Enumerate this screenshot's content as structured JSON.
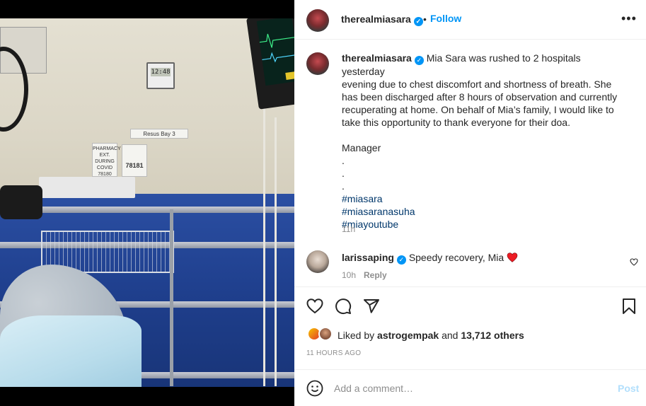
{
  "post_header": {
    "username": "therealmiasara",
    "separator": "•",
    "follow_label": "Follow",
    "more_icon": "more-horizontal-icon"
  },
  "photo": {
    "clock_text": "12:48",
    "sign_bay": "Resus Bay 3",
    "sign_pharmacy": "PHARMACY EXT. DURING COVID 78180",
    "sign_ext": "78181"
  },
  "caption": {
    "username": "therealmiasara",
    "lines": [
      "Mia Sara was rushed to 2 hospitals yesterday",
      "evening due to chest discomfort and shortness of breath. She",
      "has been discharged after 8 hours of observation and currently",
      "recuperating at home. On behalf of Mia’s family, I would like to",
      "take this opportunity to thank everyone for their doa."
    ],
    "signoff": "Manager",
    "dots": [
      ".",
      ".",
      "."
    ],
    "hashtags": [
      "#miasara",
      "#miasaranasuha",
      "#miayoutube"
    ],
    "time": "11h"
  },
  "comment": {
    "username": "larissaping",
    "text": "Speedy recovery, Mia",
    "emoji": "❤️",
    "time": "10h",
    "reply_label": "Reply"
  },
  "actions": {
    "like_icon": "heart-icon",
    "comment_icon": "comment-icon",
    "share_icon": "send-icon",
    "save_icon": "bookmark-icon",
    "liked_by_prefix": "Liked by",
    "liked_by_user": "astrogempak",
    "liked_by_and": "and",
    "likes_others": "13,712 others",
    "posted_ago": "11 HOURS AGO"
  },
  "add_comment": {
    "emoji_icon": "smiley-icon",
    "placeholder": "Add a comment…",
    "post_label": "Post"
  },
  "colors": {
    "link_blue": "#0095f6",
    "hashtag": "#00376b",
    "muted": "#8e8e8e",
    "post_disabled": "#b2dffc"
  }
}
